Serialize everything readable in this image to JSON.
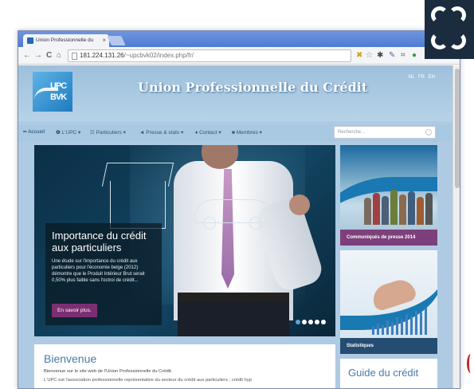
{
  "browser": {
    "tab_title": "Union Professionnelle du",
    "tab_close": "×",
    "url_host": "181.224.131.26",
    "url_path": "/~upcbvk02/index.php/fr/",
    "nav": {
      "back": "←",
      "forward": "→",
      "reload": "C",
      "home": "⌂"
    }
  },
  "site": {
    "logo_line1": "UPC",
    "logo_line2": "BVK",
    "title": "Union Professionnelle du Crédit",
    "languages": [
      "NL",
      "FR",
      "EN"
    ]
  },
  "menu": {
    "items": [
      {
        "label": "Accueil",
        "icon": "grid-icon"
      },
      {
        "label": "L'UPC ▾",
        "icon": "info-icon"
      },
      {
        "label": "Particuliers ▾",
        "icon": "people-icon"
      },
      {
        "label": "Presse & stats ▾",
        "icon": "megaphone-icon"
      },
      {
        "label": "Contact ▾",
        "icon": "pin-icon"
      },
      {
        "label": "Membres ▾",
        "icon": "lock-icon"
      }
    ],
    "search_placeholder": "Recherche..."
  },
  "hero": {
    "title": "Importance du crédit aux particuliers",
    "text": "Une étude sur l'importance du crédit aux particuliers pour l'économie belge (2012) démontre que le Produit Intérieur Brut serait 0,50% plus faible sans l'octroi de crédit...",
    "button": "En savoir plus.",
    "slide_count": 5,
    "active_slide": 1
  },
  "tiles": {
    "press_label": "Communiqués de presse 2014",
    "stats_label": "Statistiques"
  },
  "welcome": {
    "title": "Bienvenue",
    "text": "Bienvenue sur le site web de l'Union Professionnelle du Crédit.",
    "text2": "L'UPC est l'association professionnelle représentative du secteur du crédit aux particuliers ; crédit hyp"
  },
  "guide": {
    "title": "Guide du crédit"
  },
  "colors": {
    "accent_purple": "#7b2f72",
    "brand_blue": "#4b79a7",
    "header_bg": "#aecbe3"
  }
}
